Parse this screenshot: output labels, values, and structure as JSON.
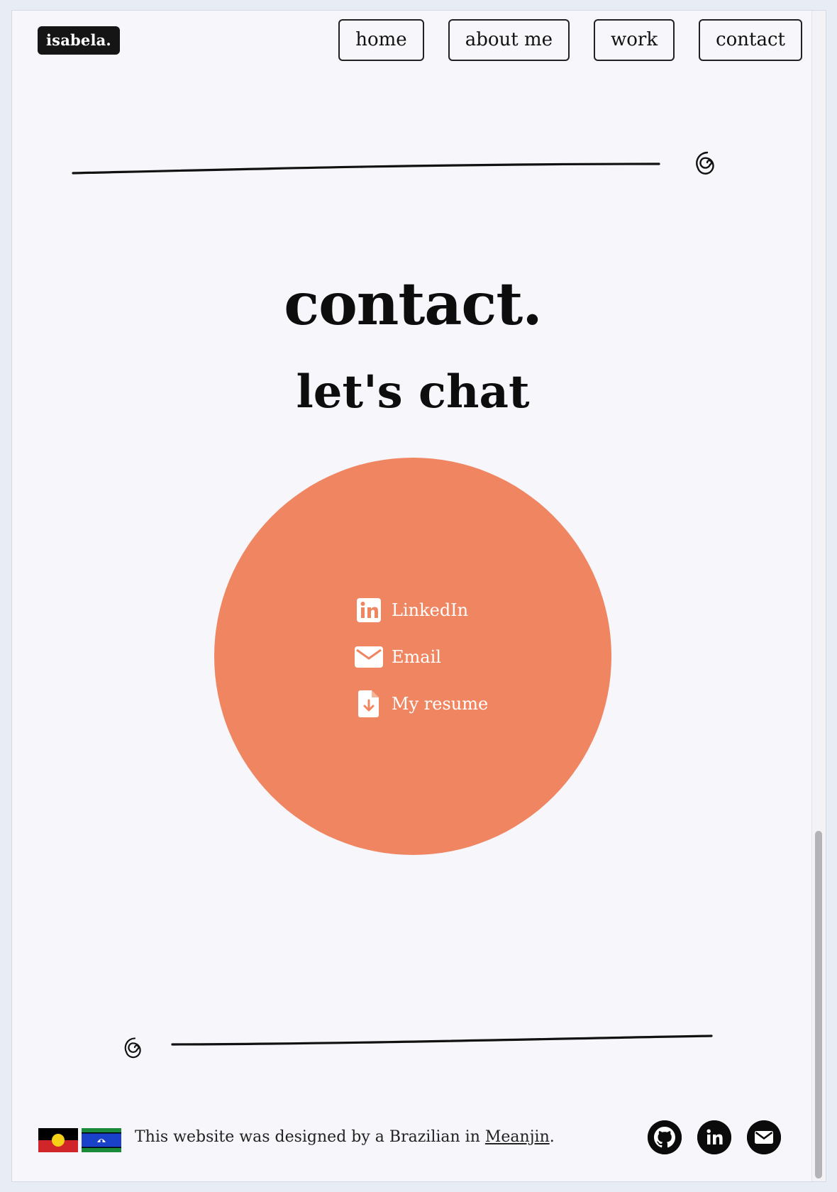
{
  "header": {
    "logo": "isabela.",
    "nav": [
      {
        "label": "home"
      },
      {
        "label": "about me"
      },
      {
        "label": "work"
      },
      {
        "label": "contact"
      }
    ]
  },
  "main": {
    "title": "contact.",
    "subtitle": "let's chat",
    "links": [
      {
        "label": "LinkedIn",
        "icon": "linkedin-icon"
      },
      {
        "label": "Email",
        "icon": "envelope-icon"
      },
      {
        "label": "My resume",
        "icon": "file-download-icon"
      }
    ],
    "circle_color": "#f08661"
  },
  "footer": {
    "text": "This website was designed by a Brazilian in ",
    "link": "Meanjin",
    "suffix": ".",
    "flags": [
      "aboriginal-flag",
      "torres-strait-islander-flag"
    ],
    "socials": [
      "github-icon",
      "linkedin-icon",
      "envelope-icon"
    ]
  }
}
